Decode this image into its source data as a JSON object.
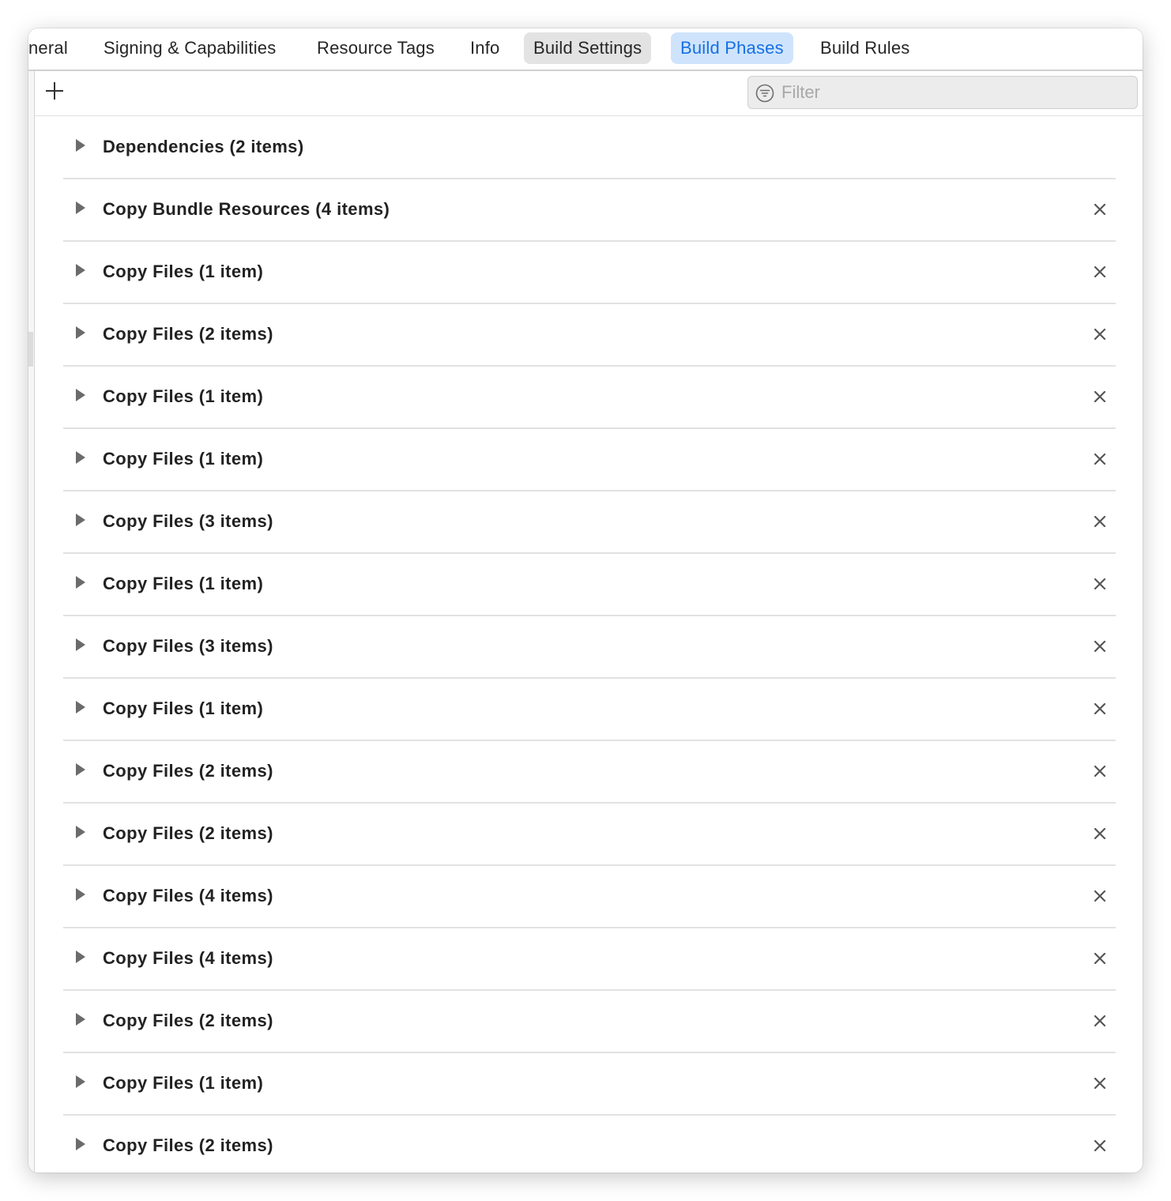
{
  "tabs": [
    {
      "label": "neral"
    },
    {
      "label": "Signing & Capabilities"
    },
    {
      "label": "Resource Tags"
    },
    {
      "label": "Info"
    },
    {
      "label": "Build Settings"
    },
    {
      "label": "Build Phases"
    },
    {
      "label": "Build Rules"
    }
  ],
  "toolbar": {
    "add_icon": "plus-icon",
    "filter_icon": "filter-icon",
    "filter_placeholder": "Filter",
    "filter_value": ""
  },
  "phases": [
    {
      "label": "Dependencies (2 items)",
      "deletable": false
    },
    {
      "label": "Copy Bundle Resources (4 items)",
      "deletable": true
    },
    {
      "label": "Copy Files (1 item)",
      "deletable": true
    },
    {
      "label": "Copy Files (2 items)",
      "deletable": true
    },
    {
      "label": "Copy Files (1 item)",
      "deletable": true
    },
    {
      "label": "Copy Files (1 item)",
      "deletable": true
    },
    {
      "label": "Copy Files (3 items)",
      "deletable": true
    },
    {
      "label": "Copy Files (1 item)",
      "deletable": true
    },
    {
      "label": "Copy Files (3 items)",
      "deletable": true
    },
    {
      "label": "Copy Files (1 item)",
      "deletable": true
    },
    {
      "label": "Copy Files (2 items)",
      "deletable": true
    },
    {
      "label": "Copy Files (2 items)",
      "deletable": true
    },
    {
      "label": "Copy Files (4 items)",
      "deletable": true
    },
    {
      "label": "Copy Files (4 items)",
      "deletable": true
    },
    {
      "label": "Copy Files (2 items)",
      "deletable": true
    },
    {
      "label": "Copy Files (1 item)",
      "deletable": true
    },
    {
      "label": "Copy Files (2 items)",
      "deletable": true
    }
  ],
  "colors": {
    "selected_tab_bg": "#cfe4fc",
    "selected_tab_text": "#1670e3",
    "highlight_tab_bg": "#e3e3e3"
  }
}
